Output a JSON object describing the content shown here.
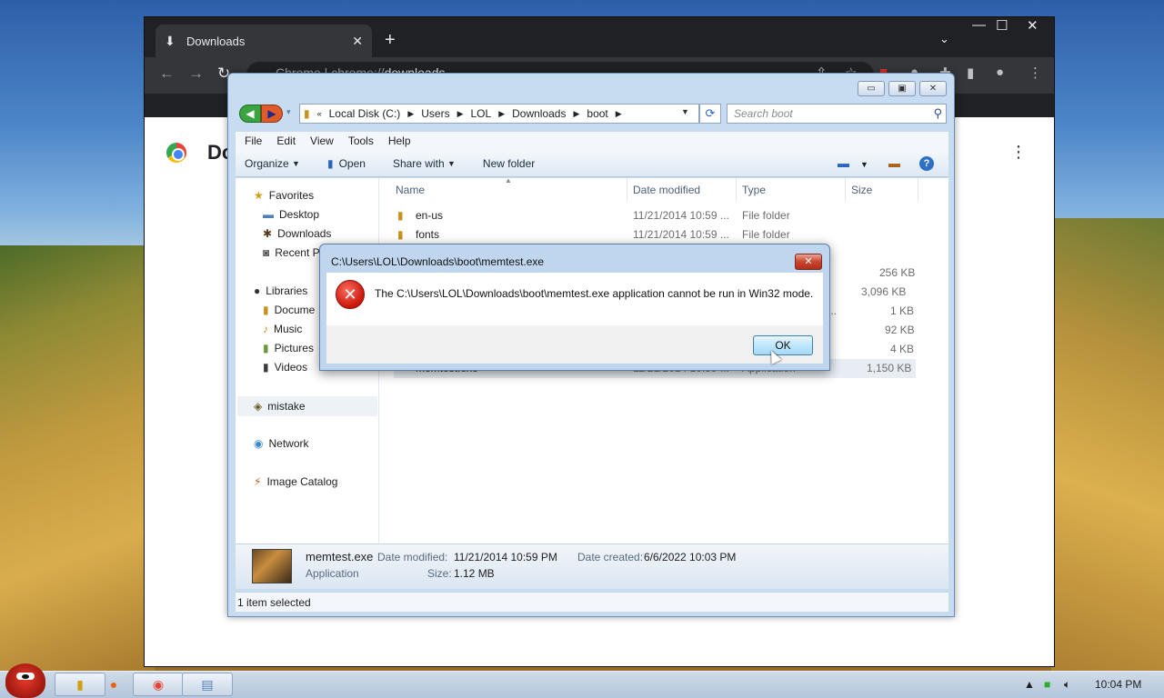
{
  "chrome": {
    "tab_title": "Downloads",
    "omnibox_scheme": "Chrome  |  chrome://",
    "omnibox_path": "downloads",
    "page_heading": "Do"
  },
  "explorer": {
    "breadcrumb": [
      "Local Disk (C:)",
      "Users",
      "LOL",
      "Downloads",
      "boot"
    ],
    "search_placeholder": "Search boot",
    "menu": [
      "File",
      "Edit",
      "View",
      "Tools",
      "Help"
    ],
    "commands": {
      "organize": "Organize",
      "open": "Open",
      "share_with": "Share with",
      "new_folder": "New folder"
    },
    "nav": {
      "favorites": "Favorites",
      "desktop": "Desktop",
      "downloads": "Downloads",
      "recent": "Recent P",
      "libraries": "Libraries",
      "documents": "Docume",
      "music": "Music",
      "pictures": "Pictures",
      "videos": "Videos",
      "homegroup": "mistake",
      "network": "Network",
      "image_catalog": "Image Catalog"
    },
    "columns": {
      "name": "Name",
      "date": "Date modified",
      "type": "Type",
      "size": "Size"
    },
    "rows": [
      {
        "name": "en-us",
        "date": "11/21/2014 10:59 ...",
        "type": "File folder",
        "size": ""
      },
      {
        "name": "fonts",
        "date": "11/21/2014 10:59 ...",
        "type": "File folder",
        "size": ""
      },
      {
        "name": "",
        "date": "",
        "type": "",
        "size": "256 KB"
      },
      {
        "name": "",
        "date": "",
        "type": "",
        "size": "3,096 KB"
      },
      {
        "name": "",
        "date": "",
        "type": "...",
        "size": "1 KB"
      },
      {
        "name": "",
        "date": "",
        "type": "",
        "size": "92 KB"
      },
      {
        "name": "",
        "date": "",
        "type": "",
        "size": "4 KB"
      },
      {
        "name": "memtest.exe",
        "date": "11/21/2014 10:59 ...",
        "type": "Application",
        "size": "1,150 KB"
      }
    ],
    "details": {
      "filename": "memtest.exe",
      "kind": "Application",
      "modified_label": "Date modified:",
      "modified_value": "11/21/2014 10:59 PM",
      "created_label": "Date created:",
      "created_value": "6/6/2022 10:03 PM",
      "size_label": "Size:",
      "size_value": "1.12 MB"
    },
    "status": "1 item selected"
  },
  "dialog": {
    "title": "C:\\Users\\LOL\\Downloads\\boot\\memtest.exe",
    "message": "The C:\\Users\\LOL\\Downloads\\boot\\memtest.exe application cannot be run in Win32 mode.",
    "ok_label": "OK"
  },
  "taskbar": {
    "clock": "10:04 PM"
  }
}
